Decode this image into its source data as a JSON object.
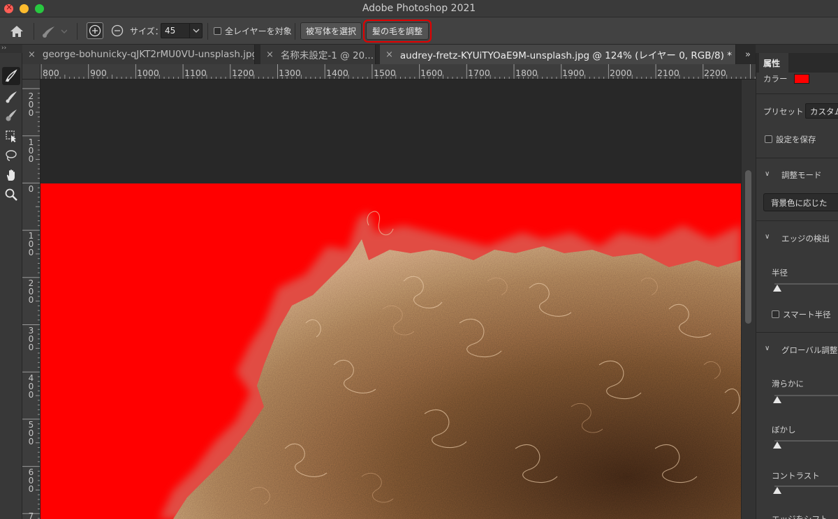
{
  "window": {
    "title": "Adobe Photoshop 2021"
  },
  "options_bar": {
    "size_label": "サイズ：",
    "size_value": "45",
    "all_layers_label": "全レイヤーを対象",
    "select_subject_label": "被写体を選択",
    "refine_hair_label": "髪の毛を調整"
  },
  "tabs": [
    {
      "label": "george-bohunicky-qJKT2rMU0VU-unsplash.jpg",
      "active": false
    },
    {
      "label": "名称未設定-1 @ 20...",
      "active": false
    },
    {
      "label": "audrey-fretz-KYUiTYOaE9M-unsplash.jpg @ 124% (レイヤー 0, RGB/8) *",
      "active": true
    }
  ],
  "ruler_top": [
    "800",
    "900",
    "1000",
    "1100",
    "1200",
    "1300",
    "1400",
    "1500",
    "1600",
    "1700",
    "1800",
    "1900",
    "2000",
    "2100",
    "2200"
  ],
  "ruler_left": [
    "2 0 0",
    "1 0 0",
    "0",
    "1 0 0",
    "2 0 0",
    "3 0 0",
    "4 0 0",
    "5 0 0",
    "6 0 0",
    "7"
  ],
  "properties": {
    "tab_label": "属性",
    "color_label": "カラー",
    "color_value": "#ff0000",
    "preset_label": "プリセット",
    "preset_value": "カスタム",
    "save_settings_label": "設定を保存",
    "adjust_mode_label": "調整モード",
    "adjust_mode_value": "背景色に応じた",
    "edge_detect_label": "エッジの検出",
    "radius_label": "半径",
    "smart_radius_label": "スマート半径",
    "global_adjust_label": "グローバル調整",
    "smooth_label": "滑らかに",
    "feather_label": "ぼかし",
    "contrast_label": "コントラスト",
    "shift_edge_label": "エッジをシフト"
  }
}
